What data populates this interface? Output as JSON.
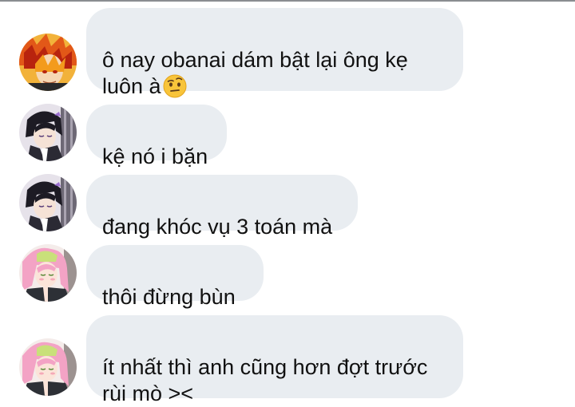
{
  "messages": [
    {
      "sender": "rengoku-avatar",
      "text": "ô nay obanai dám bật lại ông kẹ\nluôn à",
      "emoji": "face-with-raised-eyebrow"
    },
    {
      "sender": "shinobu-avatar",
      "text": "kệ nó i bặn"
    },
    {
      "sender": "shinobu-avatar",
      "text": "đang khóc vụ 3 toán mà"
    },
    {
      "sender": "mitsuri-avatar",
      "text": "thôi đừng bùn"
    },
    {
      "sender": "mitsuri-avatar",
      "text": "ít nhất thì anh cũng hơn đợt trước\nrùi mò ><"
    }
  ],
  "colors": {
    "bubble": "#e9edf1",
    "text": "#111111",
    "top_rule": "#8a8d91"
  }
}
